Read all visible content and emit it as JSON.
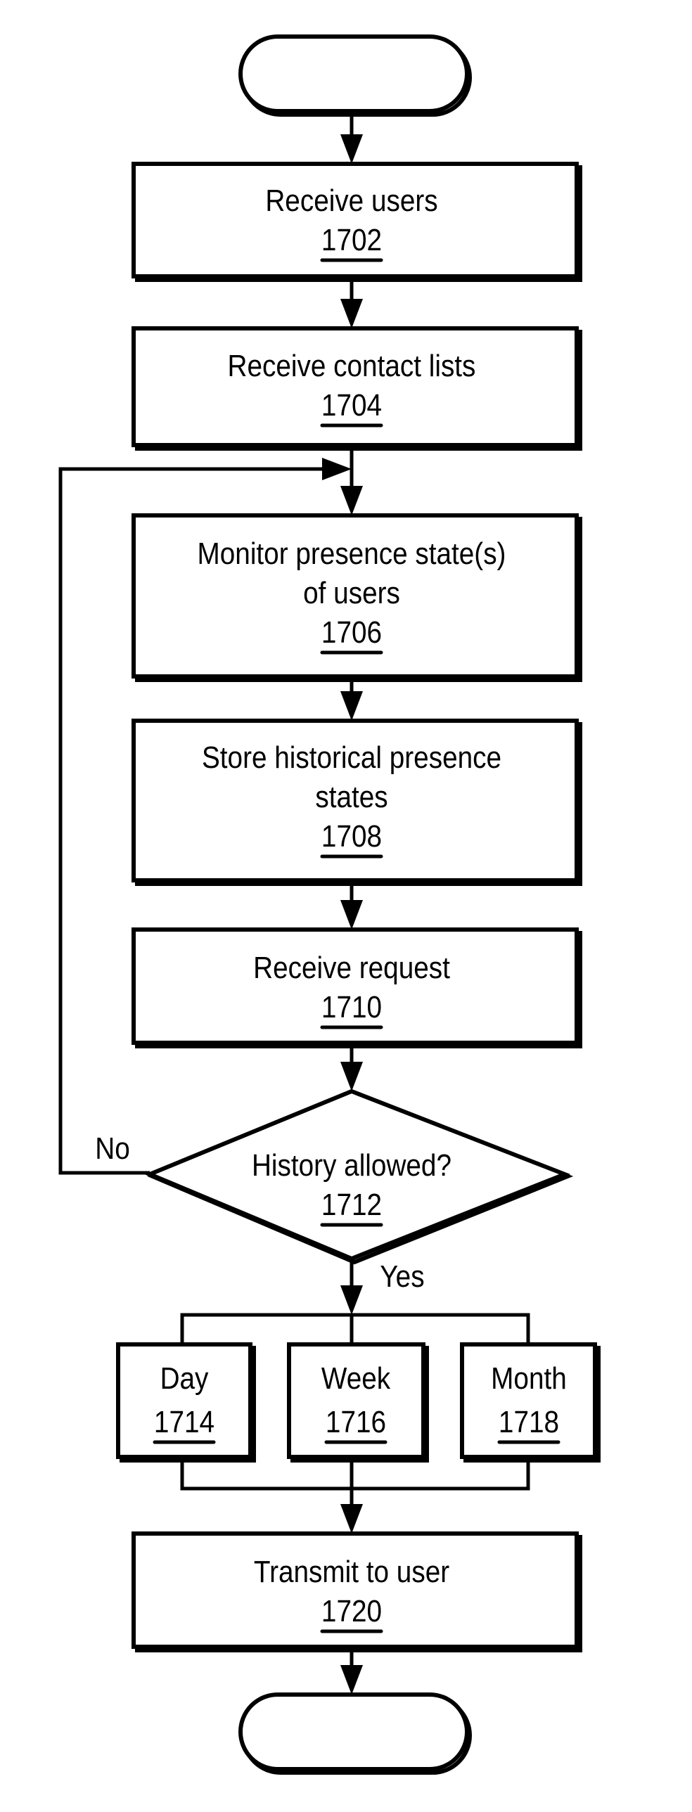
{
  "diagram": {
    "type": "flowchart",
    "start": {
      "label": ""
    },
    "end": {
      "label": ""
    },
    "steps": [
      {
        "id": "1702",
        "lines": [
          "Receive users"
        ],
        "ref": "1702"
      },
      {
        "id": "1704",
        "lines": [
          "Receive contact lists"
        ],
        "ref": "1704"
      },
      {
        "id": "1706",
        "lines": [
          "Monitor presence state(s)",
          "of users"
        ],
        "ref": "1706"
      },
      {
        "id": "1708",
        "lines": [
          "Store historical presence",
          "states"
        ],
        "ref": "1708"
      },
      {
        "id": "1710",
        "lines": [
          "Receive request"
        ],
        "ref": "1710"
      }
    ],
    "decision": {
      "id": "1712",
      "lines": [
        "History allowed?"
      ],
      "ref": "1712",
      "no_label": "No",
      "yes_label": "Yes"
    },
    "options": [
      {
        "id": "1714",
        "lines": [
          "Day"
        ],
        "ref": "1714"
      },
      {
        "id": "1716",
        "lines": [
          "Week"
        ],
        "ref": "1716"
      },
      {
        "id": "1718",
        "lines": [
          "Month"
        ],
        "ref": "1718"
      }
    ],
    "final_step": {
      "id": "1720",
      "lines": [
        "Transmit to user"
      ],
      "ref": "1720"
    }
  }
}
